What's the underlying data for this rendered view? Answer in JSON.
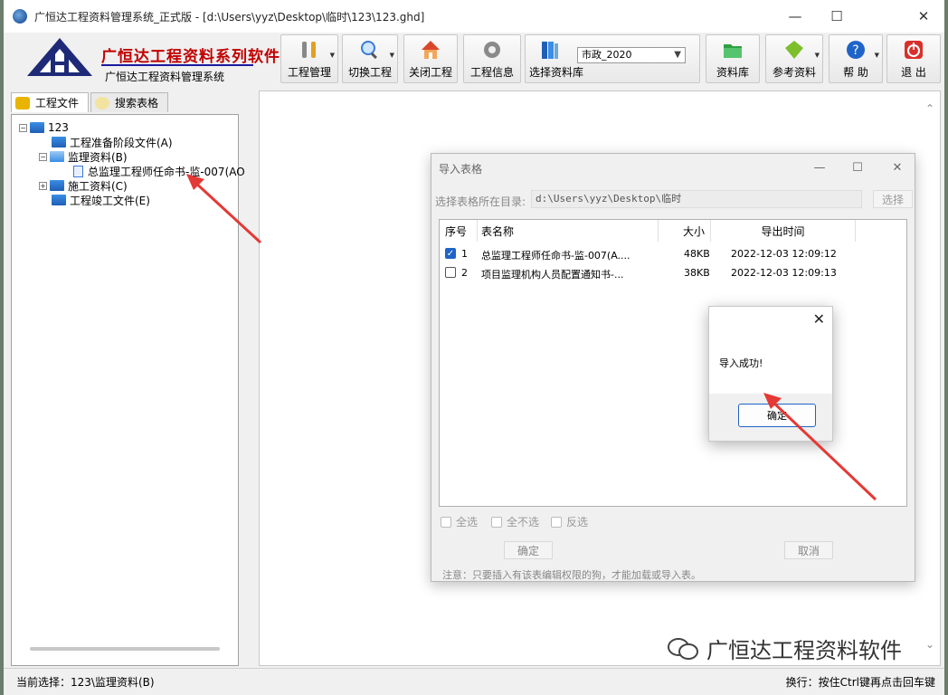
{
  "window": {
    "title": "广恒达工程资料管理系统_正式版 - [d:\\Users\\yyz\\Desktop\\临时\\123\\123.ghd]",
    "minimize": "—",
    "maximize": "☐",
    "close": "✕"
  },
  "brand": {
    "title": "广恒达工程资料系列软件",
    "subtitle": "广恒达工程资料管理系统"
  },
  "toolbar": {
    "project_mgmt": "工程管理",
    "switch_project": "切换工程",
    "close_project": "关闭工程",
    "project_info": "工程信息",
    "select_library": "选择资料库",
    "library_value": "市政_2020",
    "library": "资料库",
    "reference": "参考资料",
    "help": "帮 助",
    "exit": "退 出"
  },
  "left_tabs": {
    "project_files": "工程文件",
    "search_forms": "搜索表格"
  },
  "tree": {
    "root": "123",
    "nodes": [
      "工程准备阶段文件(A)",
      "监理资料(B)",
      "总监理工程师任命书-监-007(AO",
      "施工资料(C)",
      "工程竣工文件(E)"
    ]
  },
  "import_dialog": {
    "title": "导入表格",
    "dir_label": "选择表格所在目录:",
    "dir_value": "d:\\Users\\yyz\\Desktop\\临时",
    "dir_button": "选择",
    "columns": [
      "序号",
      "表名称",
      "大小",
      "导出时间"
    ],
    "rows": [
      {
        "checked": true,
        "no": "1",
        "name": "总监理工程师任命书-监-007(A....",
        "size": "48KB",
        "time": "2022-12-03 12:09:12"
      },
      {
        "checked": false,
        "no": "2",
        "name": "项目监理机构人员配置通知书-...",
        "size": "38KB",
        "time": "2022-12-03 12:09:13"
      }
    ],
    "select_all": "全选",
    "select_none": "全不选",
    "invert": "反选",
    "ok": "确定",
    "cancel": "取消",
    "note": "注意：只要插入有该表编辑权限的狗，才能加载或导入表。"
  },
  "message_box": {
    "text": "导入成功!",
    "ok": "确定",
    "close": "✕"
  },
  "status": {
    "left": "当前选择：123\\监理资料(B)",
    "right": "换行：按住Ctrl键再点击回车键"
  },
  "watermark": "广恒达工程资料软件",
  "colors": {
    "brand_red": "#c00000",
    "accent_blue": "#1f64c8",
    "annotation_arrow": "#e53935"
  }
}
